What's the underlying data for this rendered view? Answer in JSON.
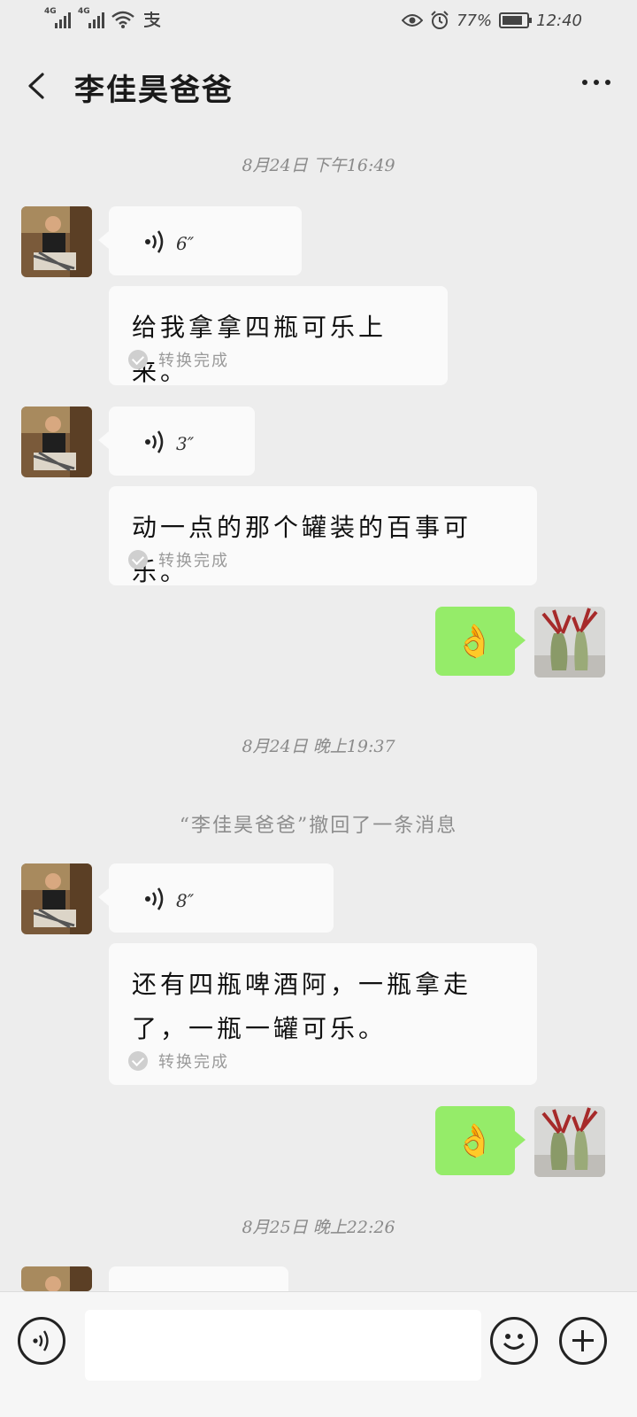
{
  "status_bar": {
    "network1": "4G",
    "network2": "4G",
    "battery": "77%",
    "time": "12:40"
  },
  "header": {
    "title": "李佳昊爸爸"
  },
  "separators": {
    "t1": "8月24日 下午16:49",
    "t2": "8月24日 晚上19:37",
    "t3": "8月25日 晚上22:26"
  },
  "recall_notice": "“李佳昊爸爸”撤回了一条消息",
  "messages": {
    "voice1": {
      "duration": "6″"
    },
    "text1": {
      "text": "给我拿拿四瓶可乐上来。",
      "status": "转换完成"
    },
    "voice2": {
      "duration": "3″"
    },
    "text2": {
      "text": "动一点的那个罐装的百事可乐。",
      "status": "转换完成"
    },
    "reply1": {
      "emoji": "👌"
    },
    "voice3": {
      "duration": "8″"
    },
    "text3": {
      "text": "还有四瓶啤酒阿，一瓶拿走了，一瓶一罐可乐。",
      "status": "转换完成"
    },
    "reply2": {
      "emoji": "👌"
    }
  },
  "input": {
    "placeholder": ""
  }
}
